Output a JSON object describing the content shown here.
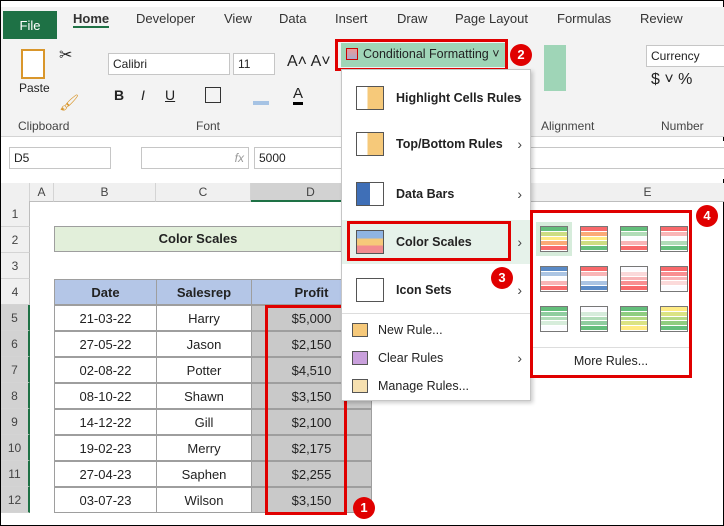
{
  "tabs": [
    "File",
    "Home",
    "Developer",
    "View",
    "Data",
    "Insert",
    "Draw",
    "Page Layout",
    "Formulas",
    "Review"
  ],
  "ribbon": {
    "paste": "Paste",
    "font_name": "Calibri",
    "font_size": "11",
    "number_format": "Currency",
    "groups": {
      "clipboard": "Clipboard",
      "font": "Font",
      "alignment": "Alignment",
      "number": "Number"
    },
    "cf_button": "Conditional Formatting"
  },
  "formula_bar": {
    "name_box": "D5",
    "value": "5000",
    "fx": "fx"
  },
  "columns": [
    "A",
    "B",
    "C",
    "D",
    "E"
  ],
  "rows": [
    "1",
    "2",
    "3",
    "4",
    "5",
    "6",
    "7",
    "8",
    "9",
    "10",
    "11",
    "12"
  ],
  "sheet": {
    "title": "Color Scales",
    "headers": [
      "Date",
      "Salesrep",
      "Profit"
    ],
    "data": [
      [
        "21-03-22",
        "Harry",
        "$5,000"
      ],
      [
        "27-05-22",
        "Jason",
        "$2,150"
      ],
      [
        "02-08-22",
        "Potter",
        "$4,510"
      ],
      [
        "08-10-22",
        "Shawn",
        "$3,150"
      ],
      [
        "14-12-22",
        "Gill",
        "$2,100"
      ],
      [
        "19-02-23",
        "Merry",
        "$2,175"
      ],
      [
        "27-04-23",
        "Saphen",
        "$2,255"
      ],
      [
        "03-07-23",
        "Wilson",
        "$3,150"
      ]
    ]
  },
  "menu": {
    "items": [
      "Highlight Cells Rules",
      "Top/Bottom Rules",
      "Data Bars",
      "Color Scales",
      "Icon Sets"
    ],
    "small": [
      "New Rule...",
      "Clear Rules",
      "Manage Rules..."
    ]
  },
  "submenu": {
    "more": "More Rules...",
    "scales": [
      [
        "#63be7b",
        "#cddd82",
        "#ffeb84",
        "#fbaa77",
        "#f8696b"
      ],
      [
        "#f8696b",
        "#fbaa77",
        "#ffeb84",
        "#cddd82",
        "#63be7b"
      ],
      [
        "#63be7b",
        "#b1dcb8",
        "#fcfcff",
        "#f9b5b7",
        "#f8696b"
      ],
      [
        "#f8696b",
        "#f9b5b7",
        "#fcfcff",
        "#b1dcb8",
        "#63be7b"
      ],
      [
        "#5a8ac6",
        "#abc4e3",
        "#fcfcff",
        "#f9b5b7",
        "#f8696b"
      ],
      [
        "#f8696b",
        "#f9b5b7",
        "#fcfcff",
        "#abc4e3",
        "#5a8ac6"
      ],
      [
        "#fcfcff",
        "#fbd9da",
        "#f9b5b7",
        "#f98f91",
        "#f8696b"
      ],
      [
        "#f8696b",
        "#f98f91",
        "#f9b5b7",
        "#fbd9da",
        "#fcfcff"
      ],
      [
        "#63be7b",
        "#8fcd9f",
        "#b1dcb8",
        "#d6ecdb",
        "#fcfcff"
      ],
      [
        "#fcfcff",
        "#d6ecdb",
        "#b1dcb8",
        "#8fcd9f",
        "#63be7b"
      ],
      [
        "#63be7b",
        "#8fcd80",
        "#b5d982",
        "#dbe383",
        "#ffeb84"
      ],
      [
        "#ffeb84",
        "#dbe383",
        "#b5d982",
        "#8fcd80",
        "#63be7b"
      ]
    ]
  },
  "badges": [
    "1",
    "2",
    "3",
    "4"
  ],
  "colors": {
    "excel_green": "#1e7145",
    "highlight": "#e00000",
    "header_fill": "#b4c6e7",
    "title_fill": "#e2efda"
  }
}
